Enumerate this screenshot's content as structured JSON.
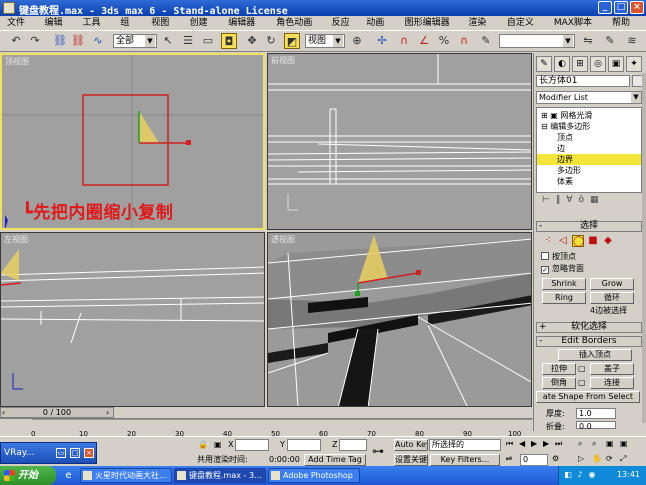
{
  "window": {
    "title": "键盘教程.max - 3ds max 6 - Stand-alone License"
  },
  "menu": [
    "文件(F)",
    "编辑(E)",
    "工具(T)",
    "组(G)",
    "视图(V)",
    "创建(C)",
    "编辑器(M)",
    "角色动画(H)",
    "反应器",
    "动画(A)",
    "图形编辑器(D)",
    "渲染(R)",
    "自定义(U)",
    "MAX脚本(M)",
    "帮助(H)"
  ],
  "toolbar": {
    "selection_filter": "全部",
    "ref_coord": "视图"
  },
  "viewports": {
    "top_left_label": "顶视图",
    "top_right_label": "前视图",
    "bottom_left_label": "左视图",
    "bottom_right_label": "透视图",
    "annotation": "先把内圈缩小复制"
  },
  "command_panel": {
    "object_name": "长方体01",
    "modifier_list": "Modifier List",
    "stack": [
      {
        "label": "⊞ ▣ 网格光滑",
        "selected": false
      },
      {
        "label": "⊟ 编辑多边形",
        "selected": false
      },
      {
        "label": "顶点",
        "selected": false
      },
      {
        "label": "边",
        "selected": false
      },
      {
        "label": "边界",
        "selected": true
      },
      {
        "label": "多边形",
        "selected": false
      },
      {
        "label": "体素",
        "selected": false
      }
    ],
    "selection_rollout": {
      "title": "选择",
      "by_vertex": "按顶点",
      "ignore_backfacing": "忽略背面",
      "shrink": "Shrink",
      "grow": "Grow",
      "ring": "Ring",
      "loop": "循环",
      "status": "4边被选择"
    },
    "soft_selection_title": "软化选择",
    "edit_borders": {
      "title": "Edit Borders",
      "insert_vertex": "插入顶点",
      "extrude": "拉伸",
      "cap": "盖子",
      "chamfer": "倒角",
      "bridge": "连接",
      "create_shape": "ate Shape From Select",
      "thickness_label": "厚度:",
      "thickness_value": "1.0",
      "fold_label": "折叠:",
      "fold_value": "0.0"
    }
  },
  "timeline": {
    "frame_slider": "0 / 100",
    "ticks": [
      "0",
      "10",
      "20",
      "30",
      "40",
      "50",
      "60",
      "70",
      "80",
      "90",
      "100"
    ]
  },
  "status": {
    "x_label": "X",
    "y_label": "Y",
    "z_label": "Z",
    "auto_key": "Auto Key",
    "selected_label": "所选择的",
    "set_key": "设置关键",
    "key_filters": "Key Filters...",
    "render_time_label": "共用渲染时间:",
    "render_time": "0:00:00",
    "add_time_tag": "Add Time Tag",
    "frame_value": "0"
  },
  "vray_window": "VRay...",
  "taskbar": {
    "start": "开始",
    "tasks": [
      {
        "label": "火星时代动画大社...",
        "active": false
      },
      {
        "label": "键盘教程.max - 3...",
        "active": true
      },
      {
        "label": "Adobe Photoshop",
        "active": false
      }
    ],
    "clock": "13:41"
  }
}
